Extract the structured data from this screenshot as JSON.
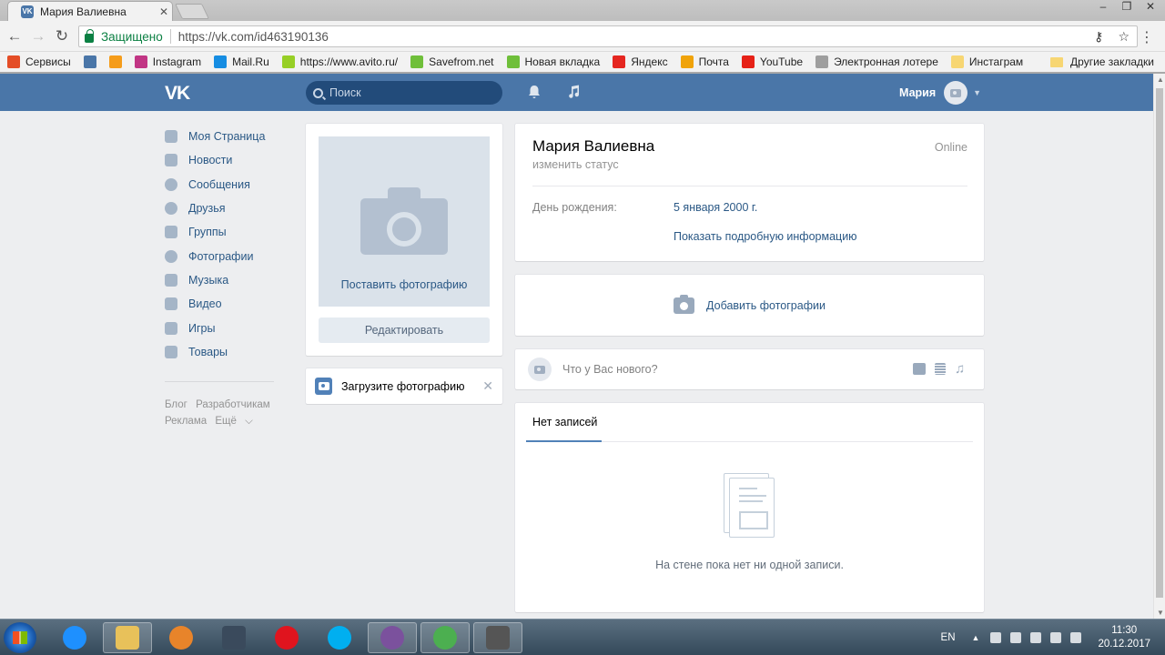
{
  "browser": {
    "tab_title": "Мария Валиевна",
    "tab_favicon": "VK",
    "secure_label": "Защищено",
    "url": "https://vk.com/id463190136",
    "bookmarks": [
      {
        "label": "Сервисы",
        "icon": "apps-grid-icon",
        "color": "#e44d26"
      },
      {
        "label": "",
        "icon": "vk-icon",
        "color": "#4a76a8"
      },
      {
        "label": "",
        "icon": "odnoklassniki-icon",
        "color": "#f59c1a"
      },
      {
        "label": "Instagram",
        "icon": "instagram-icon",
        "color": "#c13584"
      },
      {
        "label": "Mail.Ru",
        "icon": "mailru-icon",
        "color": "#168de2"
      },
      {
        "label": "https://www.avito.ru/",
        "icon": "avito-icon",
        "color": "#97cf26"
      },
      {
        "label": "Savefrom.net",
        "icon": "download-arrow-icon",
        "color": "#6fbf3a"
      },
      {
        "label": "Новая вкладка",
        "icon": "download-arrow-icon",
        "color": "#6fbf3a"
      },
      {
        "label": "Яндекс",
        "icon": "yandex-icon",
        "color": "#e52620"
      },
      {
        "label": "Почта",
        "icon": "mail-envelope-icon",
        "color": "#f0a30a"
      },
      {
        "label": "YouTube",
        "icon": "youtube-icon",
        "color": "#e62117"
      },
      {
        "label": "Электронная лотере",
        "icon": "page-icon",
        "color": "#9e9e9e"
      },
      {
        "label": "Инстаграм",
        "icon": "folder-icon",
        "color": "#f7d673"
      }
    ],
    "other_bookmarks": "Другие закладки"
  },
  "vk": {
    "logo": "VK",
    "search_placeholder": "Поиск",
    "user_name": "Мария",
    "nav": [
      {
        "label": "Моя Страница",
        "icon": "home-icon"
      },
      {
        "label": "Новости",
        "icon": "news-icon"
      },
      {
        "label": "Сообщения",
        "icon": "messages-icon"
      },
      {
        "label": "Друзья",
        "icon": "friends-icon"
      },
      {
        "label": "Группы",
        "icon": "groups-icon"
      },
      {
        "label": "Фотографии",
        "icon": "camera-icon"
      },
      {
        "label": "Музыка",
        "icon": "music-note-icon"
      },
      {
        "label": "Видео",
        "icon": "video-film-icon"
      },
      {
        "label": "Игры",
        "icon": "gamepad-icon"
      },
      {
        "label": "Товары",
        "icon": "shopping-bag-icon"
      }
    ],
    "footer_links": [
      "Блог",
      "Разработчикам",
      "Реклама",
      "Ещё"
    ],
    "photo_placeholder": "Поставить фотографию",
    "edit_button": "Редактировать",
    "upload_prompt": "Загрузите фотографию",
    "profile": {
      "name": "Мария Валиевна",
      "status": "изменить статус",
      "online": "Online",
      "birthday_label": "День рождения:",
      "birthday_value": "5 января 2000 г.",
      "more_info": "Показать подробную информацию"
    },
    "add_photos": "Добавить фотографии",
    "post_placeholder": "Что у Вас нового?",
    "wall_tab": "Нет записей",
    "wall_empty": "На стене пока нет ни одной записи.",
    "accent": "#4a76a8"
  },
  "taskbar": {
    "apps": [
      {
        "icon": "internet-explorer-icon",
        "color": "#1e90ff"
      },
      {
        "icon": "file-explorer-icon",
        "color": "#e8c15a"
      },
      {
        "icon": "ubuntu-style-app-icon",
        "color": "#e8842a"
      },
      {
        "icon": "kmplayer-icon",
        "color": "#3a4a5c"
      },
      {
        "icon": "opera-icon",
        "color": "#e0141e"
      },
      {
        "icon": "skype-icon",
        "color": "#00aff0"
      },
      {
        "icon": "viber-icon",
        "color": "#7b519d"
      },
      {
        "icon": "chrome-icon",
        "color": "#4caf50"
      },
      {
        "icon": "camera-app-icon",
        "color": "#555555"
      }
    ],
    "language": "EN",
    "time": "11:30",
    "date": "20.12.2017"
  }
}
